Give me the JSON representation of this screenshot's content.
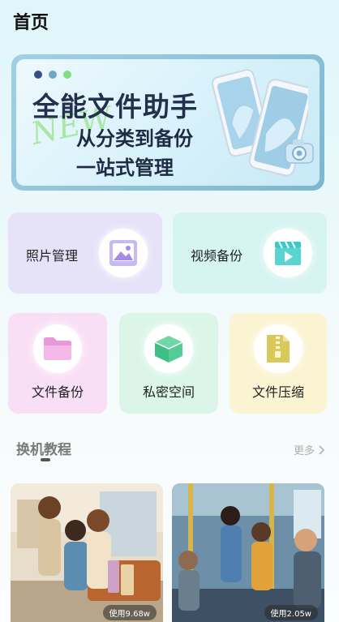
{
  "header": {
    "title": "首页"
  },
  "banner": {
    "headline": "全能文件助手",
    "line1": "从分类到备份",
    "line2": "一站式管理",
    "decor_text": "NEW"
  },
  "tiles": {
    "photo": {
      "label": "照片管理",
      "icon": "image-icon"
    },
    "video": {
      "label": "视频备份",
      "icon": "clapperboard-icon"
    },
    "files": {
      "label": "文件备份",
      "icon": "folder-icon"
    },
    "private": {
      "label": "私密空间",
      "icon": "box-icon"
    },
    "zip": {
      "label": "文件压缩",
      "icon": "zip-file-icon"
    }
  },
  "section": {
    "title": "换机教程",
    "more": "更多"
  },
  "cards": [
    {
      "usage": "使用9.68w"
    },
    {
      "usage": "使用2.05w"
    }
  ]
}
